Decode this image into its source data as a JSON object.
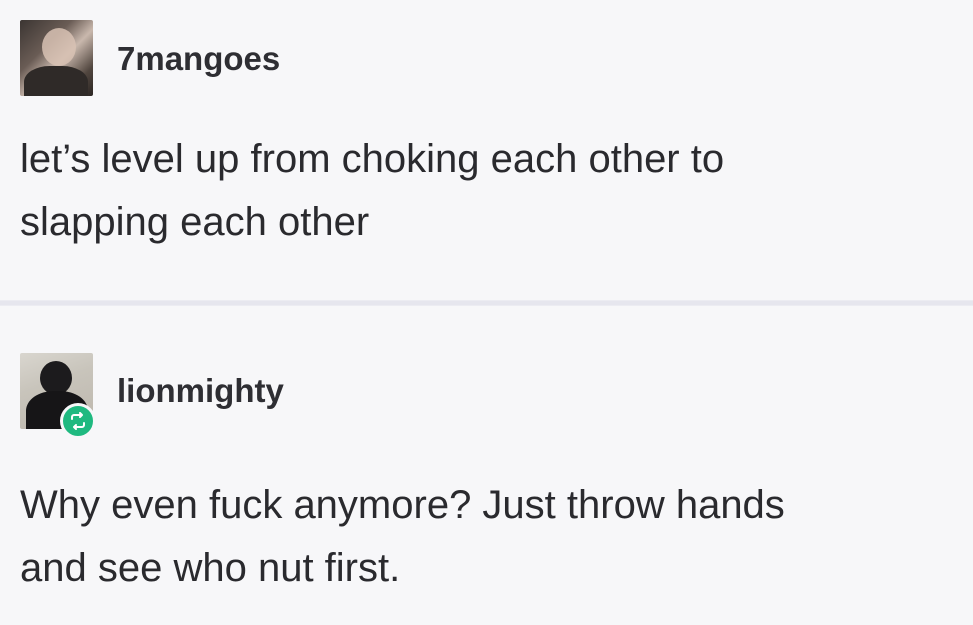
{
  "posts": [
    {
      "username": "7mangoes",
      "text_lines": [
        "let’s level up from choking each other to",
        "slapping each other"
      ]
    },
    {
      "username": "lionmighty",
      "text_lines": [
        "Why even fuck anymore? Just throw hands",
        "and see who nut first."
      ]
    }
  ],
  "icons": {
    "reblog": "reblog-icon"
  },
  "colors": {
    "reblog_badge": "#1fb980",
    "background": "#f7f7f9",
    "text": "#2a2a2e"
  }
}
